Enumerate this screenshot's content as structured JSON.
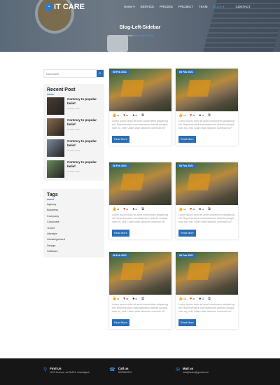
{
  "header": {
    "logo": "IT CARE",
    "nav": [
      "Home ▾",
      "SERVICE",
      "PRICING",
      "PROJECT",
      "TEAM",
      "BLOG ▾",
      "CONTACT"
    ],
    "title": "Blog-Left-Sidebar",
    "breadcrumb_home": "Home /",
    "breadcrumb_current": "Blog-Left-Sidebar"
  },
  "sidebar": {
    "search_placeholder": "Username",
    "recent_title": "Recent Post",
    "recent": [
      {
        "title": "Contrary to popular belief",
        "date": "01 DEC 2021"
      },
      {
        "title": "Contrary to popular belief",
        "date": "01 DEC 2021"
      },
      {
        "title": "Contrary to popular belief",
        "date": "01 DEC 2021"
      },
      {
        "title": "Contrary to popular belief",
        "date": "01 DEC 2021"
      }
    ],
    "tags_title": "Tags",
    "tags": [
      "Agency",
      "Business",
      "Company",
      "Corporate",
      "Travel",
      "Lifestyle",
      "Uncategorized",
      "Design",
      "Software"
    ]
  },
  "posts": [
    {
      "date": "08 Feb 2021",
      "likes": "1k",
      "hearts": "3k",
      "comments": "1k",
      "text": "Lorem ipsum dolor sit amet consectetur adipiscing elit. Reprehenderit exercitationem deleniti suscipit, nam eq, velit. Ullam vitae laborum commodi ot?",
      "button": "Read More"
    },
    {
      "date": "08 Feb 2021",
      "likes": "1k",
      "hearts": "3k",
      "comments": "1k",
      "text": "Lorem ipsum dolor sit amet consectetur adipiscing elit. Reprehenderit exercitationem deleniti suscipit, nam eq, velit. Ullam vitae laborum commodi ot?",
      "button": "Read More"
    },
    {
      "date": "08 Feb 2021",
      "likes": "1k",
      "hearts": "3k",
      "comments": "1k",
      "text": "Lorem ipsum dolor sit amet consectetur adipiscing elit. Reprehenderit exercitationem deleniti suscipit, nam eq, velit. Ullam vitae laborum commodi ot?",
      "button": "Read More"
    },
    {
      "date": "08 Feb 2021",
      "likes": "1k",
      "hearts": "3k",
      "comments": "1k",
      "text": "Lorem ipsum dolor sit amet consectetur adipiscing elit. Reprehenderit exercitationem deleniti suscipit, nam eq, velit. Ullam vitae laborum commodi ot?",
      "button": "Read More"
    },
    {
      "date": "08 Feb 2021",
      "likes": "1k",
      "hearts": "3k",
      "comments": "1k",
      "text": "Lorem ipsum dolor sit amet consectetur adipiscing elit. Reprehenderit exercitationem deleniti suscipit, nam eq, velit. Ullam vitae laborum commodi ot?",
      "button": "Read More"
    },
    {
      "date": "08 Feb 2021",
      "likes": "1k",
      "hearts": "3k",
      "comments": "1k",
      "text": "Lorem ipsum dolor sit amet consectetur adipiscing elit. Reprehenderit exercitationem deleniti suscipit, nam eq, velit. Ullam vitae laborum commodi ot?",
      "button": "Read More"
    }
  ],
  "footer": [
    {
      "icon": "map-pin-icon",
      "title": "Find Us",
      "value": "1010 Avenue, sw 54321, chandigarh"
    },
    {
      "icon": "phone-icon",
      "title": "Call us",
      "value": "9876543210"
    },
    {
      "icon": "mail-icon",
      "title": "Mail us",
      "value": "info@itcare@gmail.com"
    }
  ]
}
